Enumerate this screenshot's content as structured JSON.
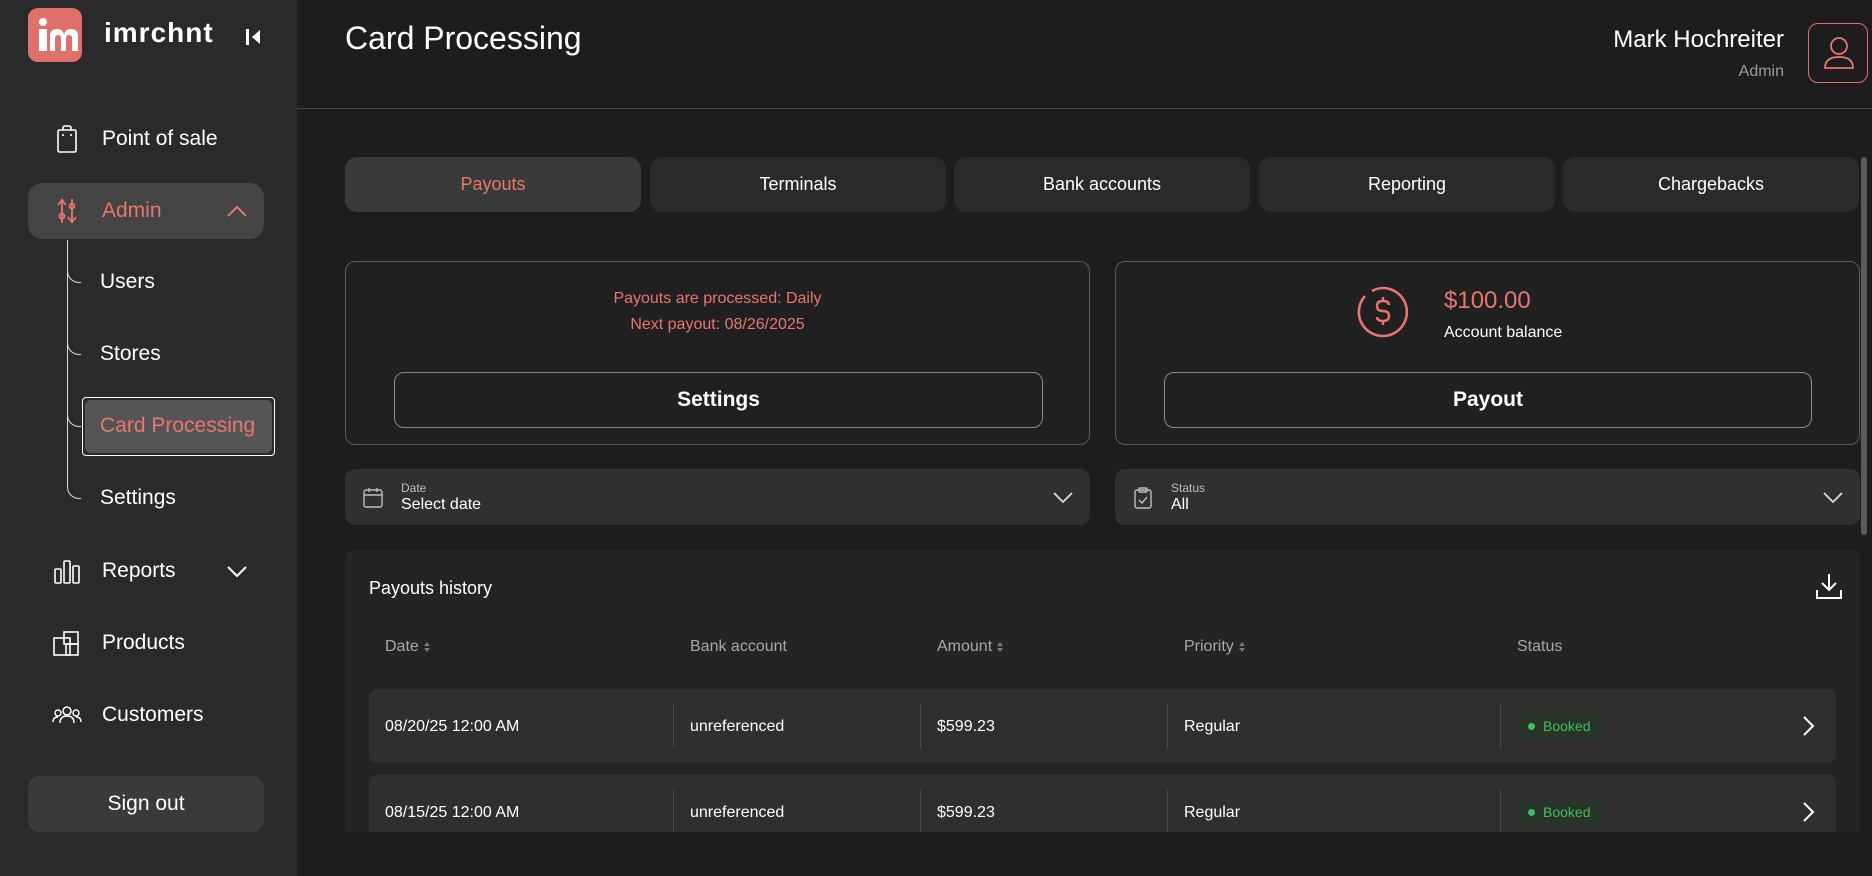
{
  "app": {
    "brand": "imrchnt",
    "brand_color": "#e0716a",
    "logo_letters": "im"
  },
  "sidebar": {
    "items": [
      {
        "label": "Point of sale",
        "icon": "shopping-bag-icon"
      },
      {
        "label": "Admin",
        "icon": "sliders-icon",
        "expanded": true
      },
      {
        "label": "Reports",
        "icon": "bar-chart-icon",
        "expanded": false
      },
      {
        "label": "Products",
        "icon": "products-icon"
      },
      {
        "label": "Customers",
        "icon": "customers-icon"
      }
    ],
    "admin_subitems": [
      {
        "label": "Users"
      },
      {
        "label": "Stores"
      },
      {
        "label": "Card Processing",
        "active": true
      },
      {
        "label": "Settings"
      }
    ],
    "sign_out": "Sign out"
  },
  "header": {
    "title": "Card Processing",
    "user_name": "Mark Hochreiter",
    "user_role": "Admin"
  },
  "tabs": [
    {
      "label": "Payouts",
      "active": true
    },
    {
      "label": "Terminals"
    },
    {
      "label": "Bank accounts"
    },
    {
      "label": "Reporting"
    },
    {
      "label": "Chargebacks"
    }
  ],
  "payout_card": {
    "schedule": "Payouts are processed: Daily",
    "next_payout": "Next payout: 08/26/2025",
    "settings_button": "Settings"
  },
  "balance_card": {
    "amount": "$100.00",
    "label": "Account balance",
    "payout_button": "Payout"
  },
  "filters": {
    "date": {
      "caption": "Date",
      "value": "Select date"
    },
    "status": {
      "caption": "Status",
      "value": "All"
    }
  },
  "history": {
    "title": "Payouts history",
    "columns": [
      "Date",
      "Bank account",
      "Amount",
      "Priority",
      "Status"
    ],
    "rows": [
      {
        "date": "08/20/25 12:00 AM",
        "bank": "unreferenced",
        "amount": "$599.23",
        "priority": "Regular",
        "status": "Booked"
      },
      {
        "date": "08/15/25 12:00 AM",
        "bank": "unreferenced",
        "amount": "$599.23",
        "priority": "Regular",
        "status": "Booked"
      }
    ]
  },
  "colors": {
    "accent": "#e8766e",
    "status_booked": "#3fbf58",
    "background": "#1d1d1d",
    "sidebar": "#2a2a2a"
  }
}
